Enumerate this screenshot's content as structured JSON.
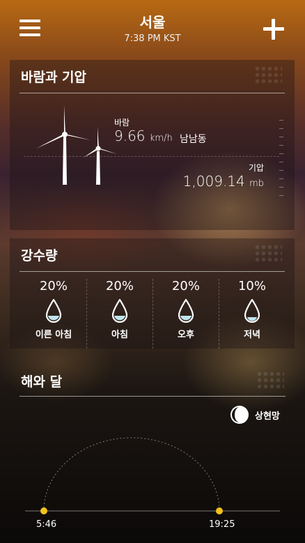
{
  "header": {
    "city": "서울",
    "time": "7:38 PM KST"
  },
  "wind_pressure": {
    "title": "바람과 기압",
    "wind_label": "바람",
    "wind_speed": "9.66",
    "wind_unit": "km/h",
    "wind_direction": "남남동",
    "pressure_label": "기압",
    "pressure_value": "1,009.14",
    "pressure_unit": "mb"
  },
  "precipitation": {
    "title": "강수량",
    "periods": [
      {
        "percent": "20%",
        "label": "이른 아침"
      },
      {
        "percent": "20%",
        "label": "아침"
      },
      {
        "percent": "20%",
        "label": "오후"
      },
      {
        "percent": "10%",
        "label": "저녁"
      }
    ]
  },
  "sun_moon": {
    "title": "해와 달",
    "moon_phase": "상현망",
    "sunrise": "5:46",
    "sunset": "19:25"
  },
  "colors": {
    "sun_marker": "#f2c21b",
    "drop_fill": "#bfe4ee"
  },
  "icons": [
    "menu-icon",
    "add-icon",
    "wind-turbine-icon",
    "water-drop-icon",
    "moon-phase-icon"
  ]
}
